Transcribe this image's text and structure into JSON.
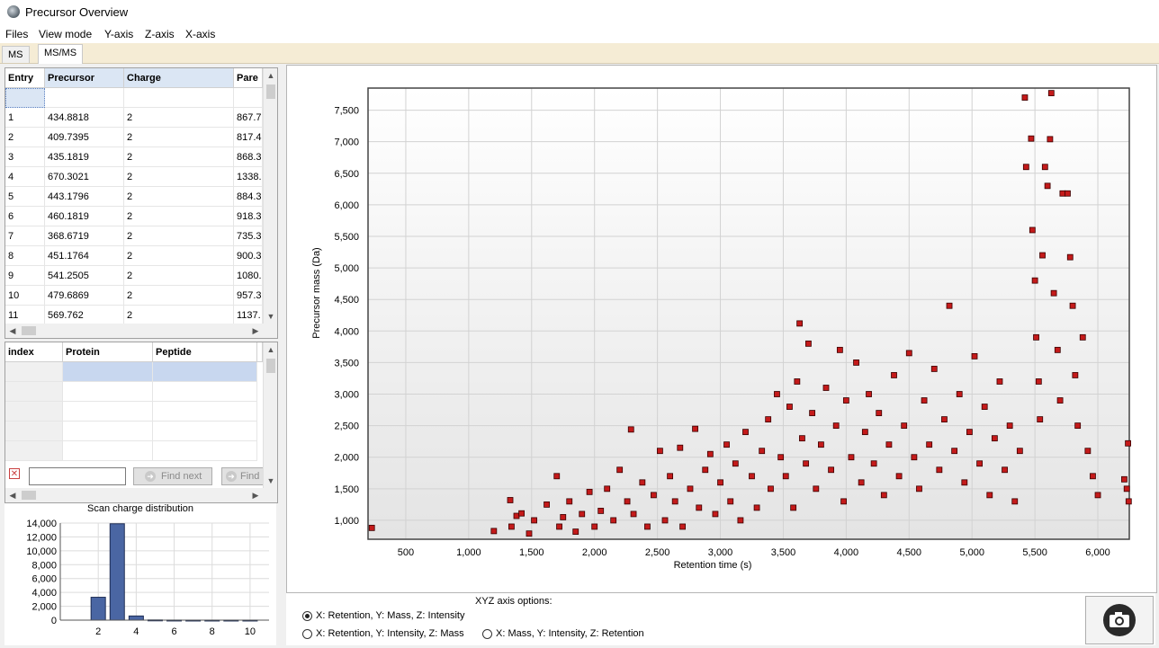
{
  "window": {
    "title": "Precursor Overview"
  },
  "menu": [
    "Files",
    "View mode",
    "Y-axis",
    "Z-axis",
    "X-axis"
  ],
  "tabs": [
    "MS",
    "MS/MS"
  ],
  "precursor_table": {
    "columns": [
      "Entry",
      "Precursor",
      "Charge",
      "Pare"
    ],
    "rows": [
      [
        "1",
        "434.8818",
        "2",
        "867.7"
      ],
      [
        "2",
        "409.7395",
        "2",
        "817.4"
      ],
      [
        "3",
        "435.1819",
        "2",
        "868.3"
      ],
      [
        "4",
        "670.3021",
        "2",
        "1338."
      ],
      [
        "5",
        "443.1796",
        "2",
        "884.3"
      ],
      [
        "6",
        "460.1819",
        "2",
        "918.3"
      ],
      [
        "7",
        "368.6719",
        "2",
        "735.3"
      ],
      [
        "8",
        "451.1764",
        "2",
        "900.3"
      ],
      [
        "9",
        "541.2505",
        "2",
        "1080."
      ],
      [
        "10",
        "479.6869",
        "2",
        "957.3"
      ],
      [
        "11",
        "569.762",
        "2",
        "1137."
      ]
    ]
  },
  "protein_table": {
    "columns": [
      "index",
      "Protein",
      "Peptide"
    ]
  },
  "search": {
    "value": "",
    "find_next_label": "Find next",
    "find_label": "Find"
  },
  "charge_chart": {
    "title": "Scan charge distribution",
    "chart_data": {
      "type": "bar",
      "x": [
        1,
        2,
        3,
        4,
        5,
        6,
        7,
        8,
        9,
        10
      ],
      "values": [
        0,
        3300,
        13900,
        600,
        30,
        10,
        5,
        5,
        5,
        5
      ],
      "ylim": [
        0,
        14000
      ],
      "xlim": [
        0,
        11
      ],
      "yticks": [
        0,
        2000,
        4000,
        6000,
        8000,
        10000,
        12000,
        14000
      ],
      "xticks": [
        2,
        4,
        6,
        8,
        10
      ],
      "ytick_labels": [
        "0",
        "2,000",
        "4,000",
        "6,000",
        "8,000",
        "10,000",
        "12,000",
        "14,000"
      ],
      "xtick_labels": [
        "2",
        "4",
        "6",
        "8",
        "10"
      ],
      "bar_color": "#4a66a3"
    }
  },
  "main_chart": {
    "chart_data": {
      "type": "scatter",
      "xlabel": "Retention time (s)",
      "ylabel": "Precursor mass (Da)",
      "xlim": [
        200,
        6250
      ],
      "ylim": [
        700,
        7850
      ],
      "xticks": [
        500,
        1000,
        1500,
        2000,
        2500,
        3000,
        3500,
        4000,
        4500,
        5000,
        5500,
        6000
      ],
      "yticks": [
        1000,
        1500,
        2000,
        2500,
        3000,
        3500,
        4000,
        4500,
        5000,
        5500,
        6000,
        6500,
        7000,
        7500
      ],
      "xtick_labels": [
        "500",
        "1,000",
        "1,500",
        "2,000",
        "2,500",
        "3,000",
        "3,500",
        "4,000",
        "4,500",
        "5,000",
        "5,500",
        "6,000"
      ],
      "ytick_labels": [
        "1,000",
        "1,500",
        "2,000",
        "2,500",
        "3,000",
        "3,500",
        "4,000",
        "4,500",
        "5,000",
        "5,500",
        "6,000",
        "6,500",
        "7,000",
        "7,500"
      ],
      "marker_color": "#c41a1a",
      "points": [
        [
          230,
          880
        ],
        [
          1200,
          830
        ],
        [
          1330,
          1320
        ],
        [
          1340,
          900
        ],
        [
          1380,
          1070
        ],
        [
          1420,
          1110
        ],
        [
          1480,
          790
        ],
        [
          1520,
          1000
        ],
        [
          1620,
          1250
        ],
        [
          1700,
          1700
        ],
        [
          1720,
          900
        ],
        [
          1750,
          1050
        ],
        [
          1800,
          1300
        ],
        [
          1850,
          820
        ],
        [
          1900,
          1100
        ],
        [
          1960,
          1450
        ],
        [
          2000,
          900
        ],
        [
          2050,
          1150
        ],
        [
          2100,
          1500
        ],
        [
          2150,
          1000
        ],
        [
          2200,
          1800
        ],
        [
          2260,
          1300
        ],
        [
          2290,
          2440
        ],
        [
          2310,
          1100
        ],
        [
          2380,
          1600
        ],
        [
          2420,
          900
        ],
        [
          2470,
          1400
        ],
        [
          2520,
          2100
        ],
        [
          2560,
          1000
        ],
        [
          2600,
          1700
        ],
        [
          2640,
          1300
        ],
        [
          2680,
          2150
        ],
        [
          2700,
          900
        ],
        [
          2760,
          1500
        ],
        [
          2800,
          2450
        ],
        [
          2830,
          1200
        ],
        [
          2880,
          1800
        ],
        [
          2920,
          2050
        ],
        [
          2960,
          1100
        ],
        [
          3000,
          1600
        ],
        [
          3050,
          2200
        ],
        [
          3080,
          1300
        ],
        [
          3120,
          1900
        ],
        [
          3160,
          1000
        ],
        [
          3200,
          2400
        ],
        [
          3250,
          1700
        ],
        [
          3290,
          1200
        ],
        [
          3330,
          2100
        ],
        [
          3380,
          2600
        ],
        [
          3400,
          1500
        ],
        [
          3450,
          3000
        ],
        [
          3480,
          2000
        ],
        [
          3520,
          1700
        ],
        [
          3550,
          2800
        ],
        [
          3580,
          1200
        ],
        [
          3610,
          3200
        ],
        [
          3630,
          4120
        ],
        [
          3650,
          2300
        ],
        [
          3680,
          1900
        ],
        [
          3700,
          3800
        ],
        [
          3730,
          2700
        ],
        [
          3760,
          1500
        ],
        [
          3800,
          2200
        ],
        [
          3840,
          3100
        ],
        [
          3880,
          1800
        ],
        [
          3920,
          2500
        ],
        [
          3950,
          3700
        ],
        [
          3980,
          1300
        ],
        [
          4000,
          2900
        ],
        [
          4040,
          2000
        ],
        [
          4080,
          3500
        ],
        [
          4120,
          1600
        ],
        [
          4150,
          2400
        ],
        [
          4180,
          3000
        ],
        [
          4220,
          1900
        ],
        [
          4260,
          2700
        ],
        [
          4300,
          1400
        ],
        [
          4340,
          2200
        ],
        [
          4380,
          3300
        ],
        [
          4420,
          1700
        ],
        [
          4460,
          2500
        ],
        [
          4500,
          3650
        ],
        [
          4540,
          2000
        ],
        [
          4580,
          1500
        ],
        [
          4620,
          2900
        ],
        [
          4660,
          2200
        ],
        [
          4700,
          3400
        ],
        [
          4740,
          1800
        ],
        [
          4780,
          2600
        ],
        [
          4820,
          4400
        ],
        [
          4860,
          2100
        ],
        [
          4900,
          3000
        ],
        [
          4940,
          1600
        ],
        [
          4980,
          2400
        ],
        [
          5020,
          3600
        ],
        [
          5060,
          1900
        ],
        [
          5100,
          2800
        ],
        [
          5140,
          1400
        ],
        [
          5180,
          2300
        ],
        [
          5220,
          3200
        ],
        [
          5260,
          1800
        ],
        [
          5300,
          2500
        ],
        [
          5340,
          1300
        ],
        [
          5380,
          2100
        ],
        [
          5420,
          7700
        ],
        [
          5430,
          6600
        ],
        [
          5470,
          7050
        ],
        [
          5480,
          5600
        ],
        [
          5500,
          4800
        ],
        [
          5510,
          3900
        ],
        [
          5530,
          3200
        ],
        [
          5540,
          2600
        ],
        [
          5560,
          5200
        ],
        [
          5580,
          6600
        ],
        [
          5600,
          6300
        ],
        [
          5620,
          7040
        ],
        [
          5630,
          7770
        ],
        [
          5650,
          4600
        ],
        [
          5680,
          3700
        ],
        [
          5700,
          2900
        ],
        [
          5720,
          6180
        ],
        [
          5760,
          6180
        ],
        [
          5780,
          5170
        ],
        [
          5800,
          4400
        ],
        [
          5820,
          3300
        ],
        [
          5840,
          2500
        ],
        [
          5880,
          3900
        ],
        [
          5920,
          2100
        ],
        [
          5960,
          1700
        ],
        [
          6000,
          1400
        ],
        [
          6210,
          1650
        ],
        [
          6230,
          1500
        ],
        [
          6240,
          2220
        ],
        [
          6245,
          1300
        ]
      ]
    }
  },
  "axis_options": {
    "title": "XYZ axis options:",
    "options": [
      "X: Retention, Y: Mass, Z: Intensity",
      "X: Retention, Y: Intensity, Z: Mass",
      "X: Mass,  Y: Intensity,  Z: Retention"
    ],
    "selected": 0
  },
  "icons": {
    "clear": "clear-x-icon",
    "find_next": "arrow-right-icon",
    "camera": "camera-icon"
  },
  "colors": {
    "tab_bar": "#f5ecd5",
    "selected_cell": "#c8d7ef",
    "marker": "#c41a1a",
    "bar": "#4a66a3"
  }
}
